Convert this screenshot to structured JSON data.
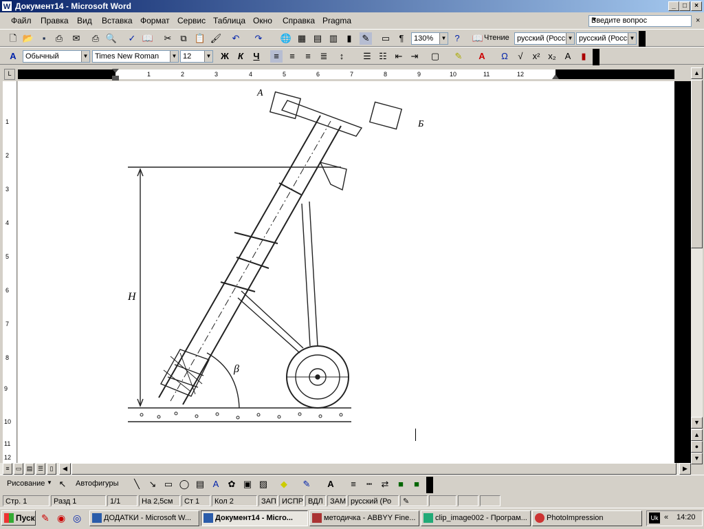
{
  "window": {
    "title": "Документ14 - Microsoft Word",
    "app_icon": "word-icon"
  },
  "menu": {
    "items": [
      "Файл",
      "Правка",
      "Вид",
      "Вставка",
      "Формат",
      "Сервис",
      "Таблица",
      "Окно",
      "Справка",
      "Pragma"
    ],
    "ask_placeholder": "Введите вопрос"
  },
  "standard_toolbar": {
    "zoom": "130%",
    "reading_label": "Чтение",
    "lang1": "русский (Росси",
    "lang2": "русский (Росси"
  },
  "format_toolbar": {
    "style": "Обычный",
    "font": "Times New Roman",
    "size": "12",
    "bold": "Ж",
    "italic": "К",
    "underline": "Ч"
  },
  "ruler": {
    "numbers": [
      "1",
      "2",
      "3",
      "4",
      "5",
      "6",
      "7",
      "8",
      "9",
      "10",
      "11",
      "12"
    ],
    "vnumbers": [
      "1",
      "2",
      "3",
      "4",
      "5",
      "6",
      "7",
      "8",
      "9",
      "10",
      "11",
      "12"
    ]
  },
  "figure": {
    "label_a": "А",
    "label_b": "Б",
    "label_h": "H",
    "label_beta": "β"
  },
  "drawing_toolbar": {
    "draw_label": "Рисование",
    "autoshapes_label": "Автофигуры"
  },
  "status": {
    "page": "Стр. 1",
    "section": "Разд 1",
    "pages": "1/1",
    "at": "На 2,5см",
    "line": "Ст 1",
    "col": "Кол 2",
    "rec": "ЗАП",
    "trk": "ИСПР",
    "ext": "ВДЛ",
    "ovr": "ЗАМ",
    "lang": "русский (Ро"
  },
  "taskbar": {
    "start": "Пуск",
    "tasks": [
      "ДОДАТКИ - Microsoft W...",
      "Документ14 - Micro...",
      "методичка - ABBYY Fine...",
      "clip_image002 - Програм...",
      "PhotoImpression"
    ],
    "lang": "Uk",
    "clock": "14:20"
  }
}
